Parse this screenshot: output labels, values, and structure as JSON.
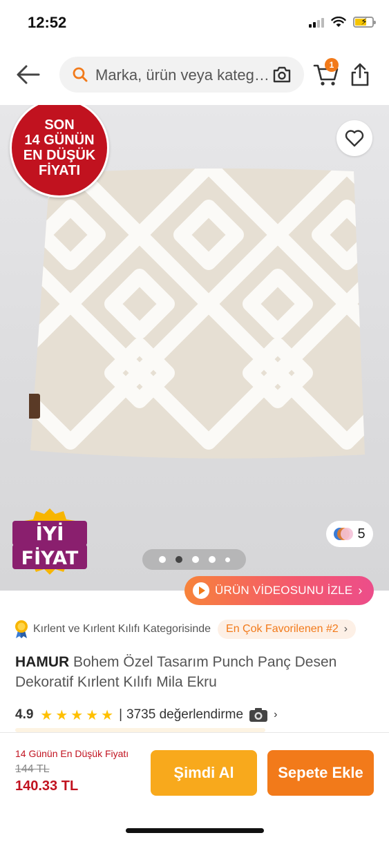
{
  "status_bar": {
    "time": "12:52"
  },
  "header": {
    "search_placeholder": "Marka, ürün veya kategori ara",
    "cart_count": "1"
  },
  "gallery": {
    "deal_badge": [
      "SON",
      "14 GÜNÜN",
      "EN DÜŞÜK",
      "FİYATI"
    ],
    "good_price_badge": [
      "İYİ",
      "FİYAT"
    ],
    "color_count": "5",
    "pager_total": 5,
    "pager_active": 2,
    "video_button": "ÜRÜN VİDEOSUNU İZLE",
    "label_tag": "HAMUR"
  },
  "category": {
    "text": "Kırlent ve Kırlent Kılıfı Kategorisinde",
    "rank": "En Çok Favorilenen #2"
  },
  "product": {
    "brand": "HAMUR",
    "name": "Bohem Özel Tasarım Punch Panç Desen Dekoratif Kırlent Kılıfı Mila Ekru"
  },
  "rating": {
    "score": "4.9",
    "stars": 5,
    "separator": "|",
    "reviews": "3735 değerlendirme"
  },
  "bottom_bar": {
    "price_label": "14 Günün En Düşük Fiyatı",
    "old_price": "144 TL",
    "price": "140.33 TL",
    "buy_now": "Şimdi Al",
    "add_to_cart": "Sepete Ekle"
  },
  "colors": {
    "accent": "#f27a1a",
    "buy_now": "#f8a91c",
    "deal_red": "#c1121f",
    "star": "#ffc000"
  }
}
